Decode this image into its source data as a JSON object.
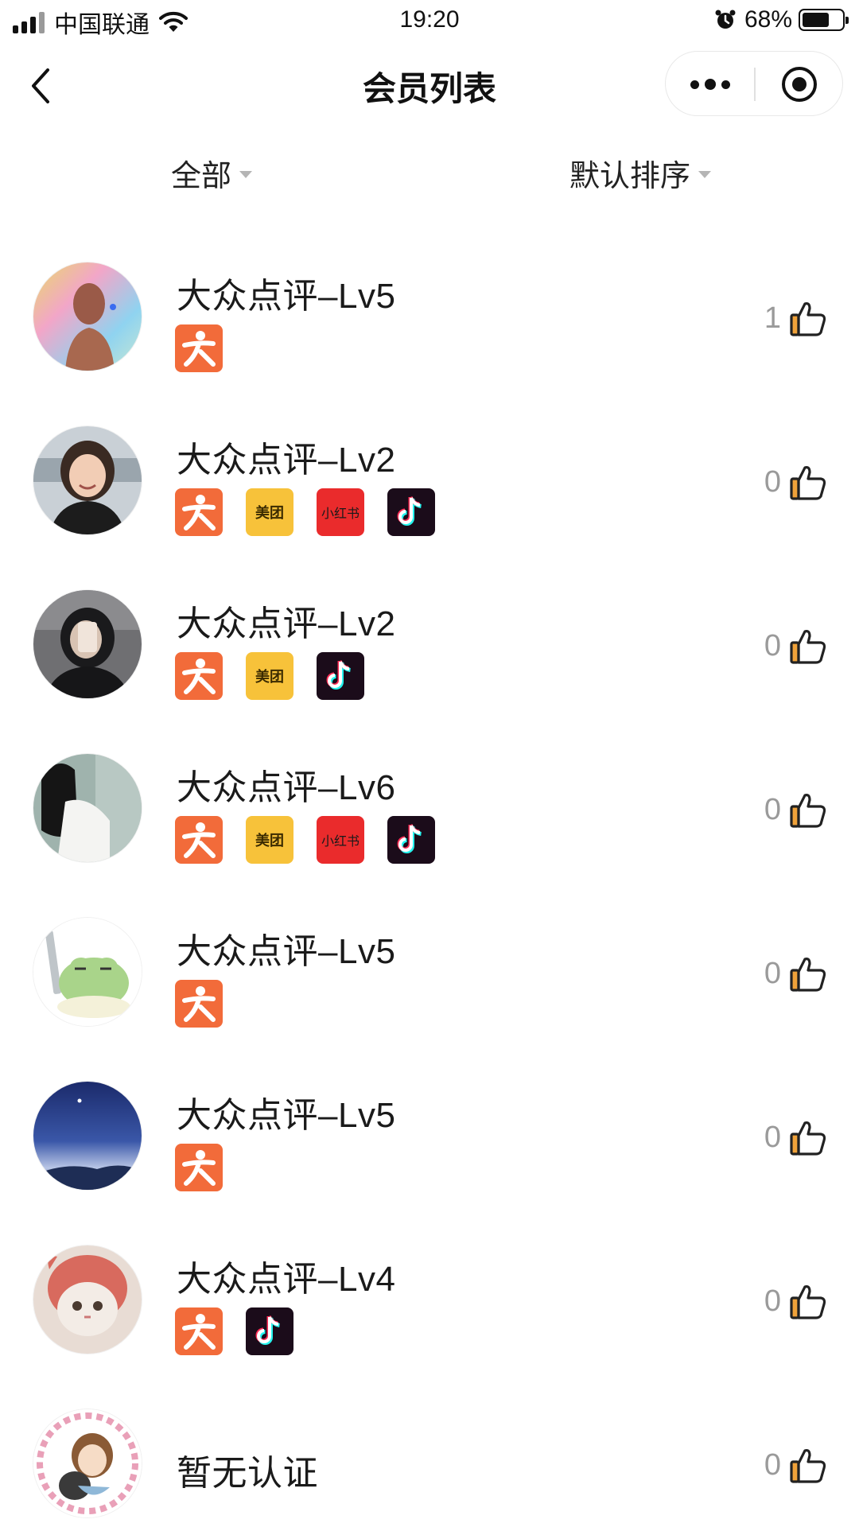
{
  "status_bar": {
    "carrier": "中国联通",
    "time": "19:20",
    "battery_percent": "68%",
    "battery_level": 0.68,
    "signal_icon": "signal-bars-icon",
    "wifi_icon": "wifi-icon",
    "alarm_icon": "alarm-icon"
  },
  "nav": {
    "title": "会员列表",
    "back_icon": "chevron-left-icon",
    "more_icon": "more-dots-icon",
    "close_icon": "target-circle-icon"
  },
  "filters": {
    "category": "全部",
    "sort": "默认排序"
  },
  "colors": {
    "dianping": "#f26b3a",
    "meituan": "#f7c23a",
    "xiaohongshu": "#ea2b2c",
    "douyin": "#1b0c1a",
    "thumb_accent": "#f0a23a"
  },
  "badge_labels": {
    "meituan": "美团",
    "xiaohongshu": "小红书"
  },
  "members": [
    {
      "name": "大众点评–Lv5",
      "avatar": "avatar-rainbow-silhouette",
      "platforms": [
        "dianping"
      ],
      "likes": "1"
    },
    {
      "name": "大众点评–Lv2",
      "avatar": "avatar-smiling-woman",
      "platforms": [
        "dianping",
        "meituan",
        "xiaohongshu",
        "douyin"
      ],
      "likes": "0"
    },
    {
      "name": "大众点评–Lv2",
      "avatar": "avatar-hooded-selfie",
      "platforms": [
        "dianping",
        "meituan",
        "douyin"
      ],
      "likes": "0"
    },
    {
      "name": "大众点评–Lv6",
      "avatar": "avatar-woman-back",
      "platforms": [
        "dianping",
        "meituan",
        "xiaohongshu",
        "douyin"
      ],
      "likes": "0"
    },
    {
      "name": "大众点评–Lv5",
      "avatar": "avatar-cartoon-frog",
      "platforms": [
        "dianping"
      ],
      "likes": "0"
    },
    {
      "name": "大众点评–Lv5",
      "avatar": "avatar-night-sky",
      "platforms": [
        "dianping"
      ],
      "likes": "0"
    },
    {
      "name": "大众点评–Lv4",
      "avatar": "avatar-cat-hood",
      "platforms": [
        "dianping",
        "douyin"
      ],
      "likes": "0"
    },
    {
      "name": "暂无认证",
      "avatar": "avatar-cartoon-girl-cat",
      "platforms": [],
      "likes": "0"
    }
  ]
}
